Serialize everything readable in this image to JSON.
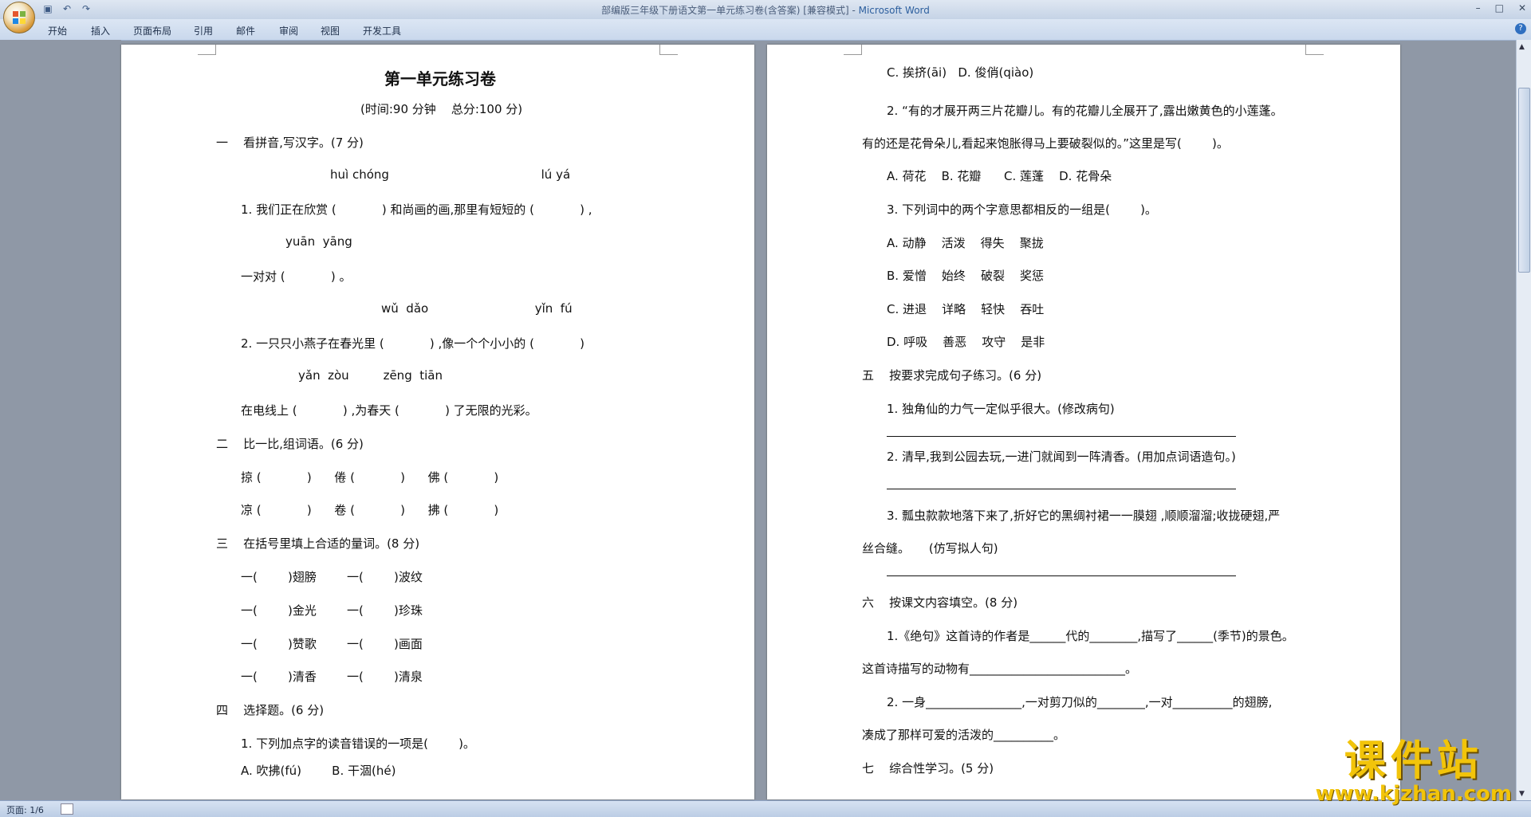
{
  "window": {
    "title": "部编版三年级下册语文第一单元练习卷(含答案) [兼容模式] - ",
    "app_name": "Microsoft Word"
  },
  "qat": {
    "save_icon": "save-icon",
    "undo_icon": "undo-icon",
    "redo_icon": "redo-icon"
  },
  "menu": [
    "开始",
    "插入",
    "页面布局",
    "引用",
    "邮件",
    "审阅",
    "视图",
    "开发工具"
  ],
  "page1": {
    "title": "第一单元练习卷",
    "subtitle": "(时间:90 分钟    总分:100 分)",
    "lines": [
      "一    看拼音,写汉字。(7 分)",
      "huì chóng                                        lú yá",
      "1. 我们正在欣赏 (            ) 和尚画的画,那里有短短的 (            ) ,",
      "yuān  yāng",
      "一对对 (            ) 。",
      "wǔ  dǎo                            yǐn  fú",
      "2. 一只只小燕子在春光里 (            ) ,像一个个小小的 (            )",
      "yǎn  zòu         zēng  tiān",
      "在电线上 (            ) ,为春天 (            ) 了无限的光彩。",
      "二    比一比,组词语。(6 分)",
      "掠 (            )      倦 (            )      佛 (            )",
      "凉 (            )      卷 (            )      拂 (            )",
      "三    在括号里填上合适的量词。(8 分)",
      "一(        )翅膀        一(        )波纹",
      "一(        )金光        一(        )珍珠",
      "一(        )赞歌        一(        )画面",
      "一(        )清香        一(        )清泉",
      "四    选择题。(6 分)",
      "1. 下列加点字的读音错误的一项是(        )。",
      "A. 吹拂(fú)        B. 干涸(hé)"
    ]
  },
  "page2": {
    "lines": [
      "C. 挨挤(āi)   D. 俊俏(qiào)",
      "2. “有的才展开两三片花瓣儿。有的花瓣儿全展开了,露出嫩黄色的小莲蓬。",
      "有的还是花骨朵儿,看起来饱胀得马上要破裂似的。”这里是写(        )。",
      "A. 荷花    B. 花瓣      C. 莲蓬    D. 花骨朵",
      "3. 下列词中的两个字意思都相反的一组是(        )。",
      "A. 动静    活泼    得失    聚拢",
      "B. 爱憎    始终    破裂    奖惩",
      "C. 进退    详略    轻快    吞吐",
      "D. 呼吸    善恶    攻守    是非",
      "五    按要求完成句子练习。(6 分)",
      "1. 独角仙的力气一定似乎很大。(修改病句)",
      "2. 清早,我到公园去玩,一进门就闻到一阵清香。(用加点词语造句。)",
      "3. 瓢虫款款地落下来了,折好它的黑绸衬裙一一膜翅 ,顺顺溜溜;收拢硬翅,严",
      "丝合缝。     (仿写拟人句)",
      "六    按课文内容填空。(8 分)",
      "1.《绝句》这首诗的作者是______代的________,描写了______(季节)的景色。",
      "这首诗描写的动物有__________________________。",
      "2. 一身________________,一对剪刀似的________,一对__________的翅膀,",
      "凑成了那样可爱的活泼的__________。",
      "七    综合性学习。(5 分)"
    ]
  },
  "status": {
    "page": "页面: 1/6"
  },
  "watermark": {
    "big": "课件站",
    "small": "www.kjzhan.com"
  },
  "colors": {
    "ribbon": "#c9d8ec",
    "page": "#ffffff",
    "workspace": "#8f98a6",
    "watermark": "#f2c40a"
  }
}
